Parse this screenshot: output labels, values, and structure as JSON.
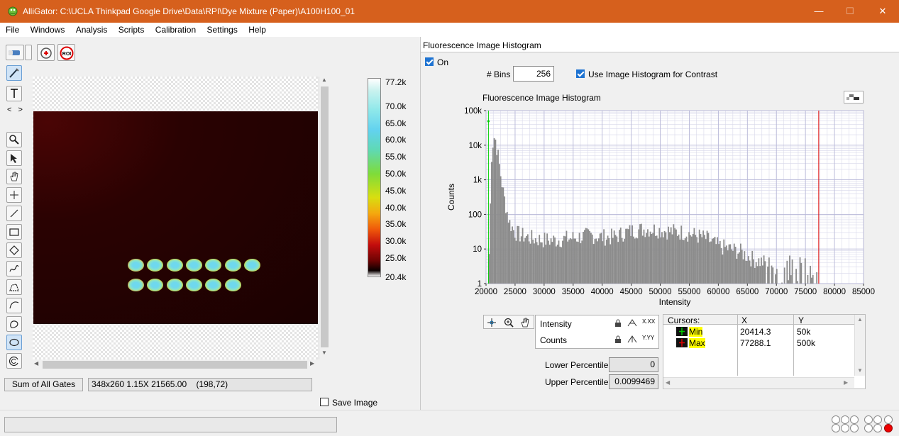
{
  "window": {
    "title": "AlliGator: C:\\UCLA Thinkpad Google Drive\\Data\\RPI\\Dye Mixture (Paper)\\A100H100_01",
    "minimize": "—",
    "maximize": "☐",
    "close": "✕"
  },
  "menu": [
    "File",
    "Windows",
    "Analysis",
    "Scripts",
    "Calibration",
    "Settings",
    "Help"
  ],
  "left": {
    "nav_arrows": "< >",
    "colorbar_ticks": [
      "77.2k",
      "70.0k",
      "65.0k",
      "60.0k",
      "55.0k",
      "50.0k",
      "45.0k",
      "40.0k",
      "35.0k",
      "30.0k",
      "25.0k",
      "20.4k"
    ],
    "gates_button": "Sum of All Gates",
    "image_info": "348x260 1.15X 21565.00    (198,72)",
    "save_image_label": "Save Image",
    "roi_icon_text": "ROI",
    "well_rows": [
      7,
      6
    ]
  },
  "right": {
    "panel_title": "Fluorescence Image Histogram",
    "on_label": "On",
    "on_checked": true,
    "bins_label": "# Bins",
    "bins_value": "256",
    "use_histogram_label": "Use Image Histogram for Contrast",
    "use_histogram_checked": true,
    "graph_title": "Fluorescence Image Histogram",
    "scale_legend": {
      "intensity": "Intensity",
      "counts": "Counts",
      "x_format": "X.XX",
      "y_format": "Y.YY"
    },
    "cursors_table": {
      "headers": [
        "Cursors:",
        "X",
        "Y"
      ],
      "rows": [
        {
          "name": "Min",
          "x": "20414.3",
          "y": "50k",
          "color": "#00cc00"
        },
        {
          "name": "Max",
          "x": "77288.1",
          "y": "500k",
          "color": "#dd0000"
        }
      ]
    },
    "lower_percentile_label": "Lower Percentile",
    "lower_percentile_value": "0",
    "upper_percentile_label": "Upper Percentile",
    "upper_percentile_value": "0.0099469"
  },
  "chart_data": {
    "type": "bar",
    "title": "Fluorescence Image Histogram",
    "xlabel": "Intensity",
    "ylabel": "Counts",
    "xlim": [
      20000,
      85000
    ],
    "ylim": [
      1,
      100000
    ],
    "yscale": "log",
    "x_ticks": [
      20000,
      25000,
      30000,
      35000,
      40000,
      45000,
      50000,
      55000,
      60000,
      65000,
      70000,
      75000,
      80000,
      85000
    ],
    "y_ticks": [
      1,
      10,
      100,
      1000,
      10000,
      100000
    ],
    "y_tick_labels": [
      "1",
      "10",
      "100",
      "1k",
      "10k",
      "100k"
    ],
    "grid": true,
    "bar_color": "#8c8c8c",
    "cursor_min_x": 20414.3,
    "cursor_max_x": 77288.1,
    "cursor_min_color": "#00cc00",
    "cursor_max_color": "#dd0000",
    "profile": [
      [
        20414,
        1
      ],
      [
        20500,
        5
      ],
      [
        21000,
        8000
      ],
      [
        21500,
        20000
      ],
      [
        22000,
        6000
      ],
      [
        22500,
        1500
      ],
      [
        23000,
        400
      ],
      [
        23500,
        150
      ],
      [
        24000,
        60
      ],
      [
        25000,
        30
      ],
      [
        26000,
        25
      ],
      [
        28000,
        20
      ],
      [
        30000,
        18
      ],
      [
        32000,
        18
      ],
      [
        34000,
        20
      ],
      [
        36000,
        22
      ],
      [
        38000,
        25
      ],
      [
        40000,
        22
      ],
      [
        42000,
        22
      ],
      [
        44000,
        30
      ],
      [
        46000,
        35
      ],
      [
        48000,
        38
      ],
      [
        50000,
        35
      ],
      [
        52000,
        32
      ],
      [
        54000,
        30
      ],
      [
        56000,
        25
      ],
      [
        58000,
        20
      ],
      [
        60000,
        12
      ],
      [
        62000,
        10
      ],
      [
        64000,
        8
      ],
      [
        66000,
        5
      ],
      [
        68000,
        4
      ],
      [
        70000,
        3
      ],
      [
        72000,
        2.5
      ],
      [
        74000,
        2
      ],
      [
        75500,
        1.5
      ],
      [
        76500,
        1.3
      ],
      [
        77288,
        1
      ]
    ],
    "bins": 256
  }
}
